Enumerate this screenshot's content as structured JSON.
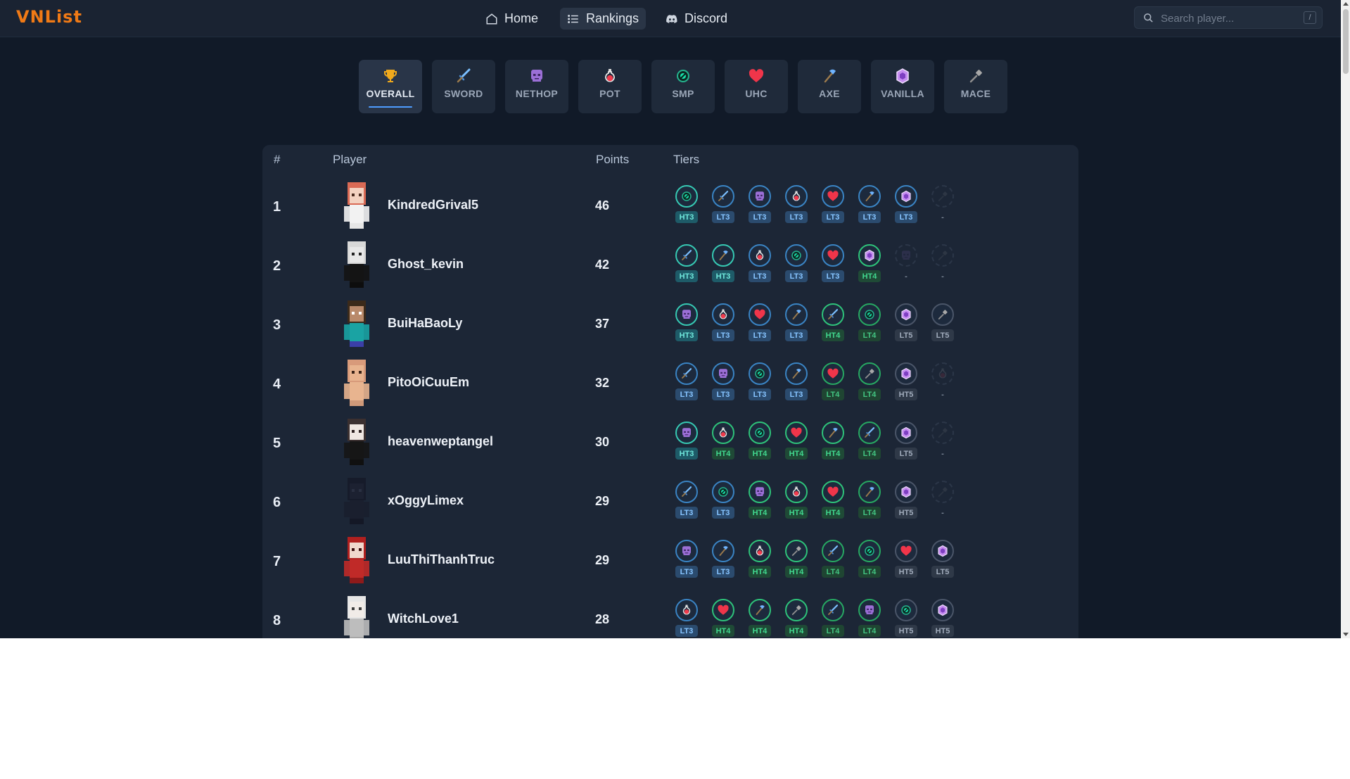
{
  "header": {
    "logo": "VNList",
    "nav": [
      {
        "label": "Home",
        "icon": "home-icon"
      },
      {
        "label": "Rankings",
        "icon": "list-icon",
        "active": true
      },
      {
        "label": "Discord",
        "icon": "discord-icon"
      }
    ],
    "search": {
      "placeholder": "Search player...",
      "shortcut": "/"
    }
  },
  "mode_tabs": [
    {
      "label": "OVERALL",
      "icon": "trophy",
      "active": true
    },
    {
      "label": "SWORD",
      "icon": "sword"
    },
    {
      "label": "NETHOP",
      "icon": "nethop"
    },
    {
      "label": "POT",
      "icon": "pot"
    },
    {
      "label": "SMP",
      "icon": "smp"
    },
    {
      "label": "UHC",
      "icon": "uhc"
    },
    {
      "label": "AXE",
      "icon": "axe"
    },
    {
      "label": "VANILLA",
      "icon": "vanilla"
    },
    {
      "label": "MACE",
      "icon": "mace"
    }
  ],
  "table": {
    "headers": {
      "rank": "#",
      "player": "Player",
      "points": "Points",
      "tiers": "Tiers"
    },
    "rows": [
      {
        "rank": "1",
        "name": "KindredGrival5",
        "points": "46",
        "avatar": "redhair",
        "tiers": [
          [
            "smp",
            "HT3"
          ],
          [
            "sword",
            "LT3"
          ],
          [
            "nethop",
            "LT3"
          ],
          [
            "pot",
            "LT3"
          ],
          [
            "uhc",
            "LT3"
          ],
          [
            "axe",
            "LT3"
          ],
          [
            "vanilla",
            "LT3"
          ],
          [
            "mace",
            "-"
          ]
        ]
      },
      {
        "rank": "2",
        "name": "Ghost_kevin",
        "points": "42",
        "avatar": "ghost",
        "tiers": [
          [
            "sword",
            "HT3"
          ],
          [
            "axe",
            "HT3"
          ],
          [
            "pot",
            "LT3"
          ],
          [
            "smp",
            "LT3"
          ],
          [
            "uhc",
            "LT3"
          ],
          [
            "vanilla",
            "HT4"
          ],
          [
            "nethop",
            "-"
          ],
          [
            "mace",
            "-"
          ]
        ]
      },
      {
        "rank": "3",
        "name": "BuiHaBaoLy",
        "points": "37",
        "avatar": "steve",
        "tiers": [
          [
            "nethop",
            "HT3"
          ],
          [
            "pot",
            "LT3"
          ],
          [
            "uhc",
            "LT3"
          ],
          [
            "axe",
            "LT3"
          ],
          [
            "sword",
            "HT4"
          ],
          [
            "smp",
            "LT4"
          ],
          [
            "vanilla",
            "LT5"
          ],
          [
            "mace",
            "LT5"
          ]
        ]
      },
      {
        "rank": "4",
        "name": "PitoOiCuuEm",
        "points": "32",
        "avatar": "bald",
        "tiers": [
          [
            "sword",
            "LT3"
          ],
          [
            "nethop",
            "LT3"
          ],
          [
            "smp",
            "LT3"
          ],
          [
            "axe",
            "LT3"
          ],
          [
            "uhc",
            "LT4"
          ],
          [
            "mace",
            "LT4"
          ],
          [
            "vanilla",
            "HT5"
          ],
          [
            "pot",
            "-"
          ]
        ]
      },
      {
        "rank": "5",
        "name": "heavenweptangel",
        "points": "30",
        "avatar": "darkhair",
        "tiers": [
          [
            "nethop",
            "HT3"
          ],
          [
            "pot",
            "HT4"
          ],
          [
            "smp",
            "HT4"
          ],
          [
            "uhc",
            "HT4"
          ],
          [
            "axe",
            "HT4"
          ],
          [
            "sword",
            "LT4"
          ],
          [
            "vanilla",
            "LT5"
          ],
          [
            "mace",
            "-"
          ]
        ]
      },
      {
        "rank": "6",
        "name": "xOggyLimex",
        "points": "29",
        "avatar": "dark",
        "tiers": [
          [
            "sword",
            "LT3"
          ],
          [
            "smp",
            "LT3"
          ],
          [
            "nethop",
            "HT4"
          ],
          [
            "pot",
            "HT4"
          ],
          [
            "uhc",
            "HT4"
          ],
          [
            "axe",
            "LT4"
          ],
          [
            "vanilla",
            "HT5"
          ],
          [
            "mace",
            "-"
          ]
        ]
      },
      {
        "rank": "7",
        "name": "LuuThiThanhTruc",
        "points": "29",
        "avatar": "red",
        "tiers": [
          [
            "nethop",
            "LT3"
          ],
          [
            "axe",
            "LT3"
          ],
          [
            "pot",
            "HT4"
          ],
          [
            "mace",
            "HT4"
          ],
          [
            "sword",
            "LT4"
          ],
          [
            "smp",
            "LT4"
          ],
          [
            "uhc",
            "HT5"
          ],
          [
            "vanilla",
            "LT5"
          ]
        ]
      },
      {
        "rank": "8",
        "name": "WitchLove1",
        "points": "28",
        "avatar": "white",
        "tiers": [
          [
            "pot",
            "LT3"
          ],
          [
            "uhc",
            "HT4"
          ],
          [
            "axe",
            "HT4"
          ],
          [
            "mace",
            "HT4"
          ],
          [
            "sword",
            "LT4"
          ],
          [
            "nethop",
            "LT4"
          ],
          [
            "smp",
            "HT5"
          ],
          [
            "vanilla",
            "HT5"
          ]
        ]
      }
    ]
  },
  "colors": {
    "background": "#111a28",
    "panel": "#1c2636",
    "logo": "#f07a16",
    "accent": "#4e9cff"
  }
}
